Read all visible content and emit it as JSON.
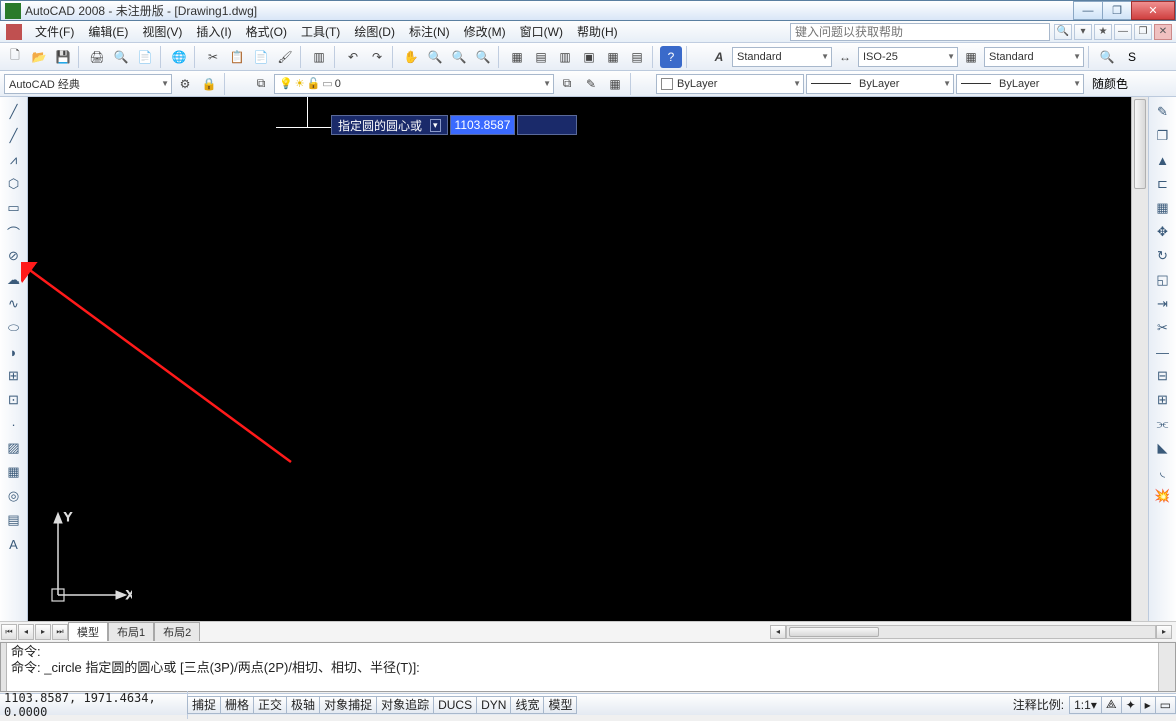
{
  "title_bar": {
    "text": "AutoCAD 2008 - 未注册版 - [Drawing1.dwg]"
  },
  "menu": {
    "file": "文件(F)",
    "edit": "编辑(E)",
    "view": "视图(V)",
    "insert": "插入(I)",
    "format": "格式(O)",
    "tools": "工具(T)",
    "draw": "绘图(D)",
    "dimension": "标注(N)",
    "modify": "修改(M)",
    "window": "窗口(W)",
    "help": "帮助(H)",
    "help_search_placeholder": "键入问题以获取帮助"
  },
  "workspace": {
    "name": "AutoCAD 经典",
    "layer_combo": "0",
    "text_style": "Standard",
    "dim_style": "ISO-25",
    "table_style": "Standard",
    "layer_prop": "ByLayer",
    "linetype": "ByLayer",
    "lineweight": "ByLayer",
    "color_label": "随颜色",
    "s_label": "S"
  },
  "dynamic_input": {
    "prompt": "指定圆的圆心或",
    "x_value": "1103.8587",
    "y_value": ""
  },
  "ucs": {
    "y": "Y",
    "x": "X"
  },
  "tabs": {
    "model": "模型",
    "layout1": "布局1",
    "layout2": "布局2"
  },
  "command": {
    "line1": "命令:",
    "line2": "命令: _circle 指定圆的圆心或 [三点(3P)/两点(2P)/相切、相切、半径(T)]:"
  },
  "status": {
    "coords": "1103.8587, 1971.4634, 0.0000",
    "snap": "捕捉",
    "grid": "栅格",
    "ortho": "正交",
    "polar": "极轴",
    "osnap": "对象捕捉",
    "otrack": "对象追踪",
    "ducs": "DUCS",
    "dyn": "DYN",
    "lwt": "线宽",
    "model": "模型",
    "anno_label": "注释比例:",
    "anno_value": "1:1"
  }
}
